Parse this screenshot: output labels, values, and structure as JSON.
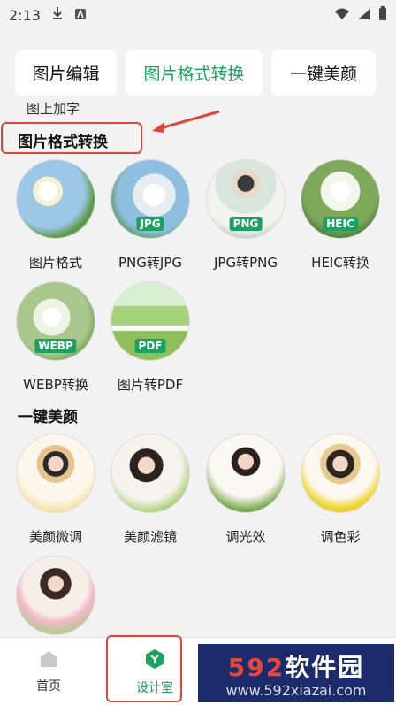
{
  "status_bar": {
    "time": "2:13",
    "download_icon": "download-icon",
    "app_icon": "app-icon",
    "wifi_icon": "wifi-icon",
    "signal_icon": "signal-icon",
    "battery_icon": "battery-icon"
  },
  "tabs": [
    {
      "label": "图片编辑",
      "active": false
    },
    {
      "label": "图片格式转换",
      "active": true
    },
    {
      "label": "一键美颜",
      "active": false
    }
  ],
  "scroll_partial_text": "图上加字",
  "sections": {
    "format": {
      "title": "图片格式转换",
      "items": [
        {
          "label": "图片格式",
          "badge": ""
        },
        {
          "label": "PNG转JPG",
          "badge": "JPG"
        },
        {
          "label": "JPG转PNG",
          "badge": "PNG"
        },
        {
          "label": "HEIC转换",
          "badge": "HEIC"
        },
        {
          "label": "WEBP转换",
          "badge": "WEBP"
        },
        {
          "label": "图片转PDF",
          "badge": "PDF"
        }
      ]
    },
    "beauty": {
      "title": "一键美颜",
      "items": [
        {
          "label": "美颜微调"
        },
        {
          "label": "美颜滤镜"
        },
        {
          "label": "调光效"
        },
        {
          "label": "调色彩"
        },
        {
          "label": ""
        }
      ]
    }
  },
  "bottom_nav": {
    "home": "首页",
    "design": "设计室"
  },
  "watermark": {
    "number": "592",
    "name": "软件园",
    "url": "www.592xiazai.com"
  },
  "colors": {
    "accent": "#1aa260",
    "highlight": "#e0453a"
  }
}
